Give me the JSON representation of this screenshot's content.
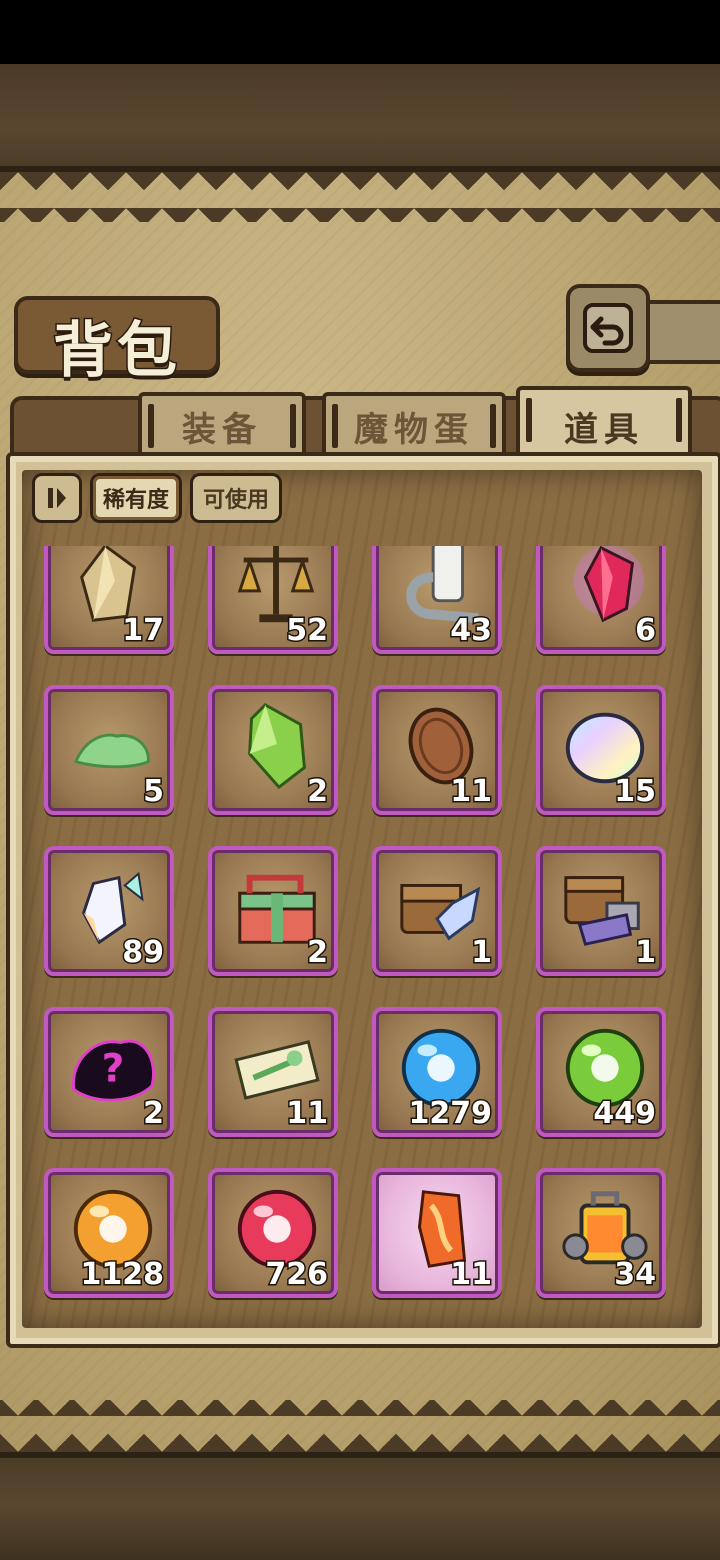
{
  "title": "背包",
  "back_button_icon": "return-arrow-icon",
  "tabs": [
    {
      "label": "装备",
      "active": false
    },
    {
      "label": "魔物蛋",
      "active": false
    },
    {
      "label": "道具",
      "active": true
    }
  ],
  "filters": {
    "sort_icon": "sort-toggle-icon",
    "rarity": "稀有度",
    "usable": "可使用"
  },
  "items": [
    {
      "icon": "topaz-crystal-icon",
      "count": "17"
    },
    {
      "icon": "scales-icon",
      "count": "52"
    },
    {
      "icon": "bandage-icon",
      "count": "43"
    },
    {
      "icon": "ruby-crystal-icon",
      "count": "6"
    },
    {
      "icon": "green-slime-icon",
      "count": "5"
    },
    {
      "icon": "emerald-crystal-icon",
      "count": "2"
    },
    {
      "icon": "bronze-coin-icon",
      "count": "11"
    },
    {
      "icon": "rainbow-egg-icon",
      "count": "15"
    },
    {
      "icon": "prism-shard-icon",
      "count": "89"
    },
    {
      "icon": "gift-box-icon",
      "count": "2"
    },
    {
      "icon": "treasure-chest-crystal-icon",
      "count": "1"
    },
    {
      "icon": "treasure-chest-ore-icon",
      "count": "1"
    },
    {
      "icon": "mystery-silhouette-icon",
      "count": "2"
    },
    {
      "icon": "sword-ticket-icon",
      "count": "11"
    },
    {
      "icon": "blue-orb-icon",
      "count": "1279"
    },
    {
      "icon": "green-orb-icon",
      "count": "449"
    },
    {
      "icon": "orange-orb-icon",
      "count": "1128"
    },
    {
      "icon": "red-orb-icon",
      "count": "726"
    },
    {
      "icon": "fire-stone-icon",
      "count": "11"
    },
    {
      "icon": "lantern-machine-icon",
      "count": "34"
    },
    {
      "icon": "partial-item-icon",
      "count": ""
    },
    {
      "icon": "partial-item-icon",
      "count": ""
    },
    {
      "icon": "partial-item-icon",
      "count": ""
    },
    {
      "icon": "partial-item-icon",
      "count": ""
    }
  ]
}
